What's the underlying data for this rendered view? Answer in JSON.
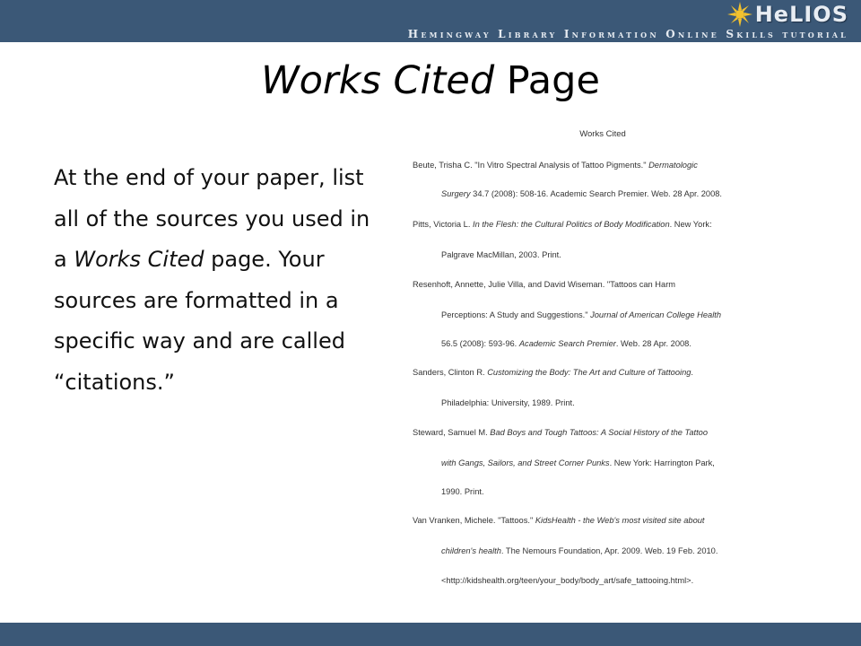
{
  "header": {
    "logo_text": "HeLIOS",
    "subtitle": "Hemingway Library Information Online Skills tutorial",
    "colors": {
      "bar": "#3b5877",
      "sun": "#f2c12e"
    }
  },
  "slide": {
    "title_italic": "Works Cited",
    "title_rest": " Page",
    "body": {
      "part1": "At the end of your paper, list all of the sources you used in a ",
      "italic": "Works Cited",
      "part2": " page. Your sources are formatted in a specific way and are called “citations.”"
    }
  },
  "citation_image": {
    "heading": "Works Cited",
    "lines": [
      {
        "pre": "Beute, Trisha C. \"In Vitro Spectral Analysis of Tattoo Pigments.\" ",
        "ital": "Dermatologic",
        "post": ""
      },
      {
        "pre": "",
        "ital": "Surgery",
        "post": " 34.7 (2008): 508-16. Academic Search Premier. Web. 28 Apr. 2008."
      },
      {
        "pre": "Pitts, Victoria L. ",
        "ital": "In the Flesh: the Cultural Politics of Body Modification",
        "post": ". New York:"
      },
      {
        "pre": "Palgrave MacMillan,  2003. Print.",
        "ital": "",
        "post": ""
      },
      {
        "pre": "Resenhoft, Annette, Julie Villa, and David  Wiseman. \"Tattoos can Harm",
        "ital": "",
        "post": ""
      },
      {
        "pre": "Perceptions: A Study and Suggestions.\" ",
        "ital": "Journal of American  College Health",
        "post": ""
      },
      {
        "pre": "56.5 (2008): 593-96. ",
        "ital": "Academic Search Premier",
        "post": ". Web. 28 Apr. 2008."
      },
      {
        "pre": "Sanders, Clinton R. ",
        "ital": "Customizing the Body: The Art and Culture of Tattooing",
        "post": "."
      },
      {
        "pre": "Philadelphia: University, 1989. Print.",
        "ital": "",
        "post": ""
      },
      {
        "pre": "Steward, Samuel M. ",
        "ital": "Bad Boys and Tough Tattoos: A Social History of the Tattoo",
        "post": ""
      },
      {
        "pre": "",
        "ital": "with Gangs, Sailors, and Street Corner Punks",
        "post": ". New York:  Harrington Park,"
      },
      {
        "pre": "1990. Print.",
        "ital": "",
        "post": ""
      },
      {
        "pre": "Van Vranken, Michele. \"Tattoos.\" ",
        "ital": "KidsHealth - the Web's most visited site about",
        "post": ""
      },
      {
        "pre": "",
        "ital": "children's health",
        "post": ". The Nemours Foundation, Apr. 2009. Web. 19 Feb. 2010."
      },
      {
        "pre": "<http://kidshealth.org/teen/your_body/body_art/safe_tattooing.html>.",
        "ital": "",
        "post": ""
      }
    ]
  }
}
